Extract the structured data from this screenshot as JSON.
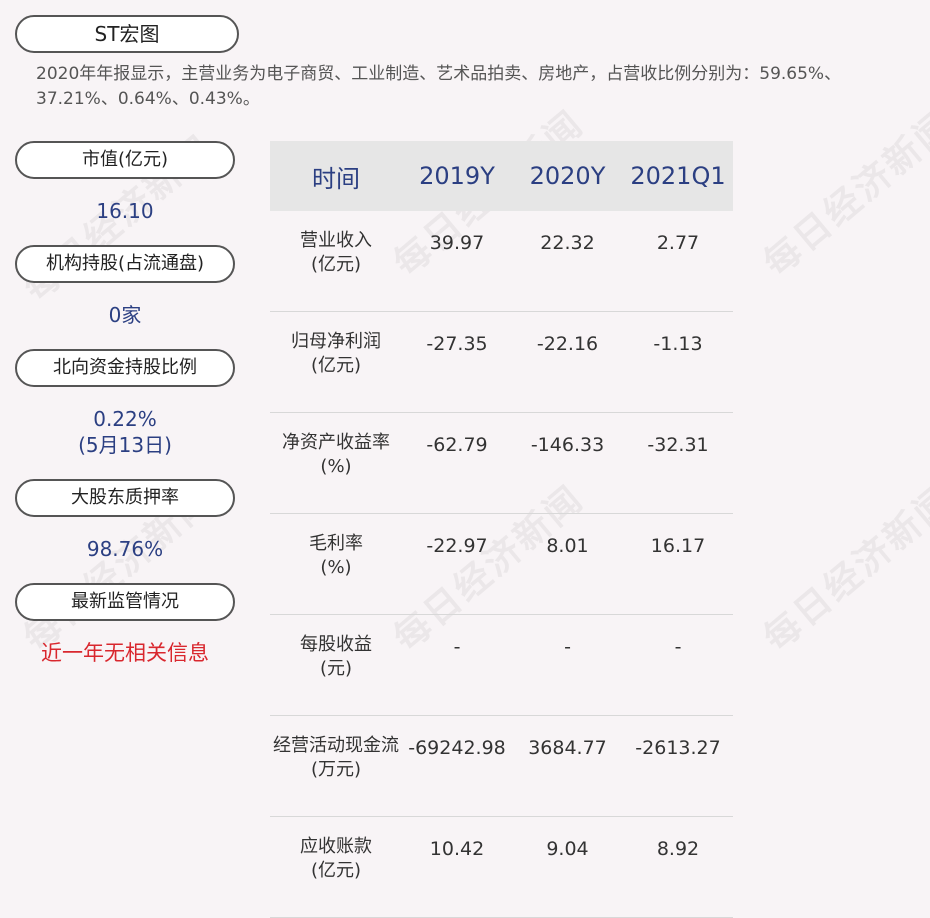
{
  "stock_name": "ST宏图",
  "summary": "2020年年报显示，主营业务为电子商贸、工业制造、艺术品拍卖、房地产，占营收比例分别为：59.65%、37.21%、0.64%、0.43%。",
  "sidebar": {
    "market_cap_label": "市值(亿元)",
    "market_cap_value": "16.10",
    "institution_label": "机构持股(占流通盘)",
    "institution_value": "0家",
    "northbound_label": "北向资金持股比例",
    "northbound_value": "0.22%",
    "northbound_date": "(5月13日)",
    "pledge_label": "大股东质押率",
    "pledge_value": "98.76%",
    "regulation_label": "最新监管情况",
    "regulation_value": "近一年无相关信息"
  },
  "table": {
    "headers": [
      "时间",
      "2019Y",
      "2020Y",
      "2021Q1"
    ],
    "rows": [
      {
        "name": "营业收入",
        "unit": "(亿元)",
        "values": [
          "39.97",
          "22.32",
          "2.77"
        ]
      },
      {
        "name": "归母净利润",
        "unit": "(亿元)",
        "values": [
          "-27.35",
          "-22.16",
          "-1.13"
        ]
      },
      {
        "name": "净资产收益率",
        "unit": "(%)",
        "values": [
          "-62.79",
          "-146.33",
          "-32.31"
        ]
      },
      {
        "name": "毛利率",
        "unit": "(%)",
        "values": [
          "-22.97",
          "8.01",
          "16.17"
        ]
      },
      {
        "name": "每股收益",
        "unit": "(元)",
        "values": [
          "-",
          "-",
          "-"
        ]
      },
      {
        "name": "经营活动现金流",
        "unit": "(万元)",
        "values": [
          "-69242.98",
          "3684.77",
          "-2613.27"
        ]
      },
      {
        "name": "应收账款",
        "unit": "(亿元)",
        "values": [
          "10.42",
          "9.04",
          "8.92"
        ]
      }
    ]
  },
  "watermark_text": "每日经济新闻",
  "colors": {
    "background": "#f8f4f6",
    "value_blue": "#2b3f82",
    "alert_red": "#d9272e",
    "header_gray": "#e6e6e6"
  }
}
